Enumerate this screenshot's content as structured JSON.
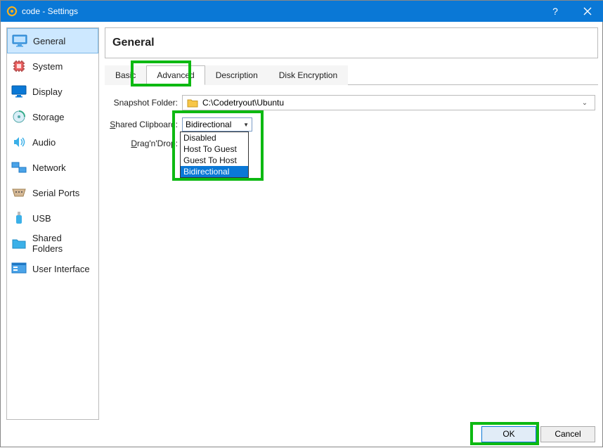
{
  "window": {
    "title": "code - Settings"
  },
  "sidebar": {
    "items": [
      {
        "label": "General"
      },
      {
        "label": "System"
      },
      {
        "label": "Display"
      },
      {
        "label": "Storage"
      },
      {
        "label": "Audio"
      },
      {
        "label": "Network"
      },
      {
        "label": "Serial Ports"
      },
      {
        "label": "USB"
      },
      {
        "label": "Shared Folders"
      },
      {
        "label": "User Interface"
      }
    ]
  },
  "header": {
    "title": "General"
  },
  "tabs": {
    "items": [
      {
        "label": "Basic"
      },
      {
        "label": "Advanced"
      },
      {
        "label": "Description"
      },
      {
        "label": "Disk Encryption"
      }
    ]
  },
  "form": {
    "snapshot_label": "Snapshot Folder:",
    "snapshot_value": "C:\\Codetryout\\Ubuntu",
    "clipboard_label_pre": "S",
    "clipboard_label_rest": "hared Clipboard:",
    "clipboard_value": "Bidirectional",
    "dragdrop_label_pre": "D",
    "dragdrop_label_rest": "rag'n'Drop:",
    "dropdown_options": [
      "Disabled",
      "Host To Guest",
      "Guest To Host",
      "Bidirectional"
    ]
  },
  "footer": {
    "ok": "OK",
    "cancel": "Cancel"
  }
}
